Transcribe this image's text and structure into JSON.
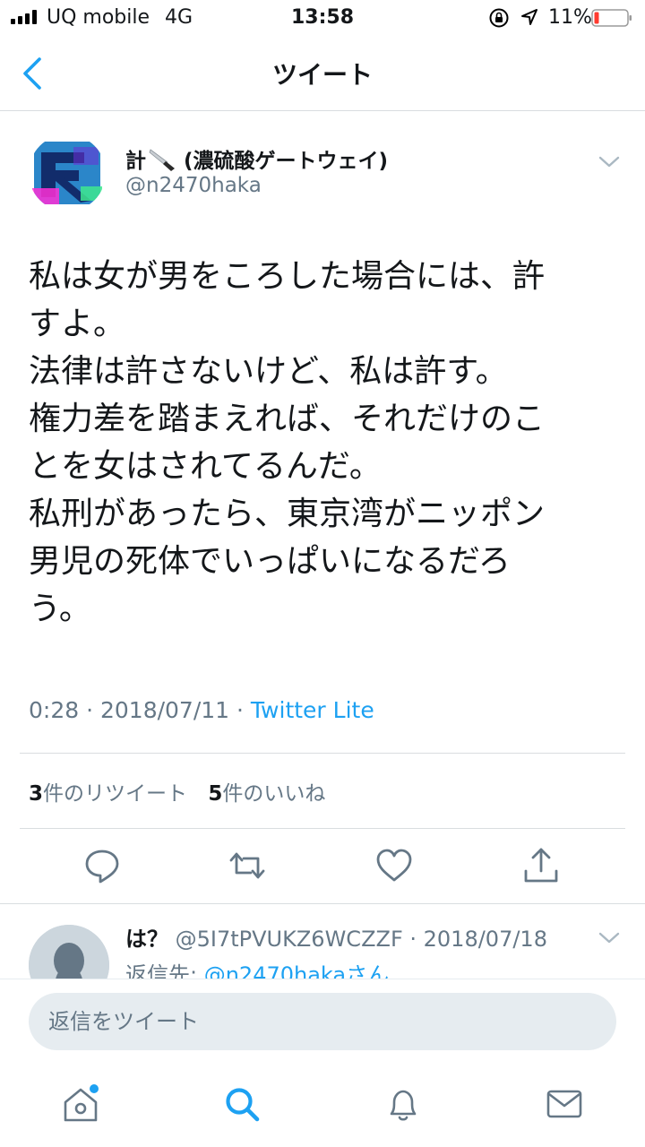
{
  "status_bar": {
    "carrier": "UQ mobile",
    "network": "4G",
    "time": "13:58",
    "battery": "11%",
    "battery_color": "#ff3b30"
  },
  "nav": {
    "title": "ツイート",
    "back_icon": "chevron-left-icon"
  },
  "tweet": {
    "author_name_prefix": "計",
    "author_emoji": "knife-icon",
    "author_name_suffix": "(濃硫酸ゲートウェイ)",
    "author_handle": "@n2470haka",
    "text_lines": [
      "私は女が男をころした場合には、許",
      "すよ。",
      "法律は許さないけど、私は許す。",
      "権力差を踏まえれば、それだけのこ",
      "とを女はされてるんだ。",
      "私刑があったら、東京湾がニッポン",
      "男児の死体でいっぱいになるだろ",
      "う。"
    ],
    "timestamp": "0:28 · 2018/07/11 · ",
    "source": "Twitter Lite",
    "retweet_count": "3",
    "retweet_label": "件のリツイート",
    "like_count": "5",
    "like_label": "件のいいね",
    "actions": [
      "reply-icon",
      "retweet-icon",
      "like-icon",
      "share-icon"
    ]
  },
  "reply": {
    "name": "は？",
    "handle_date": "@5I7tPVUKZ6WCZZF · 2018/07/18",
    "reply_to_label": "返信先: ",
    "reply_to_mention": "@n2470hakaさん"
  },
  "composer": {
    "placeholder": "返信をツイート"
  },
  "tab_bar": {
    "tabs": [
      "home-icon",
      "search-icon",
      "notifications-icon",
      "messages-icon"
    ]
  },
  "colors": {
    "accent": "#1da1f2",
    "text": "#14171a",
    "secondary": "#657786"
  }
}
